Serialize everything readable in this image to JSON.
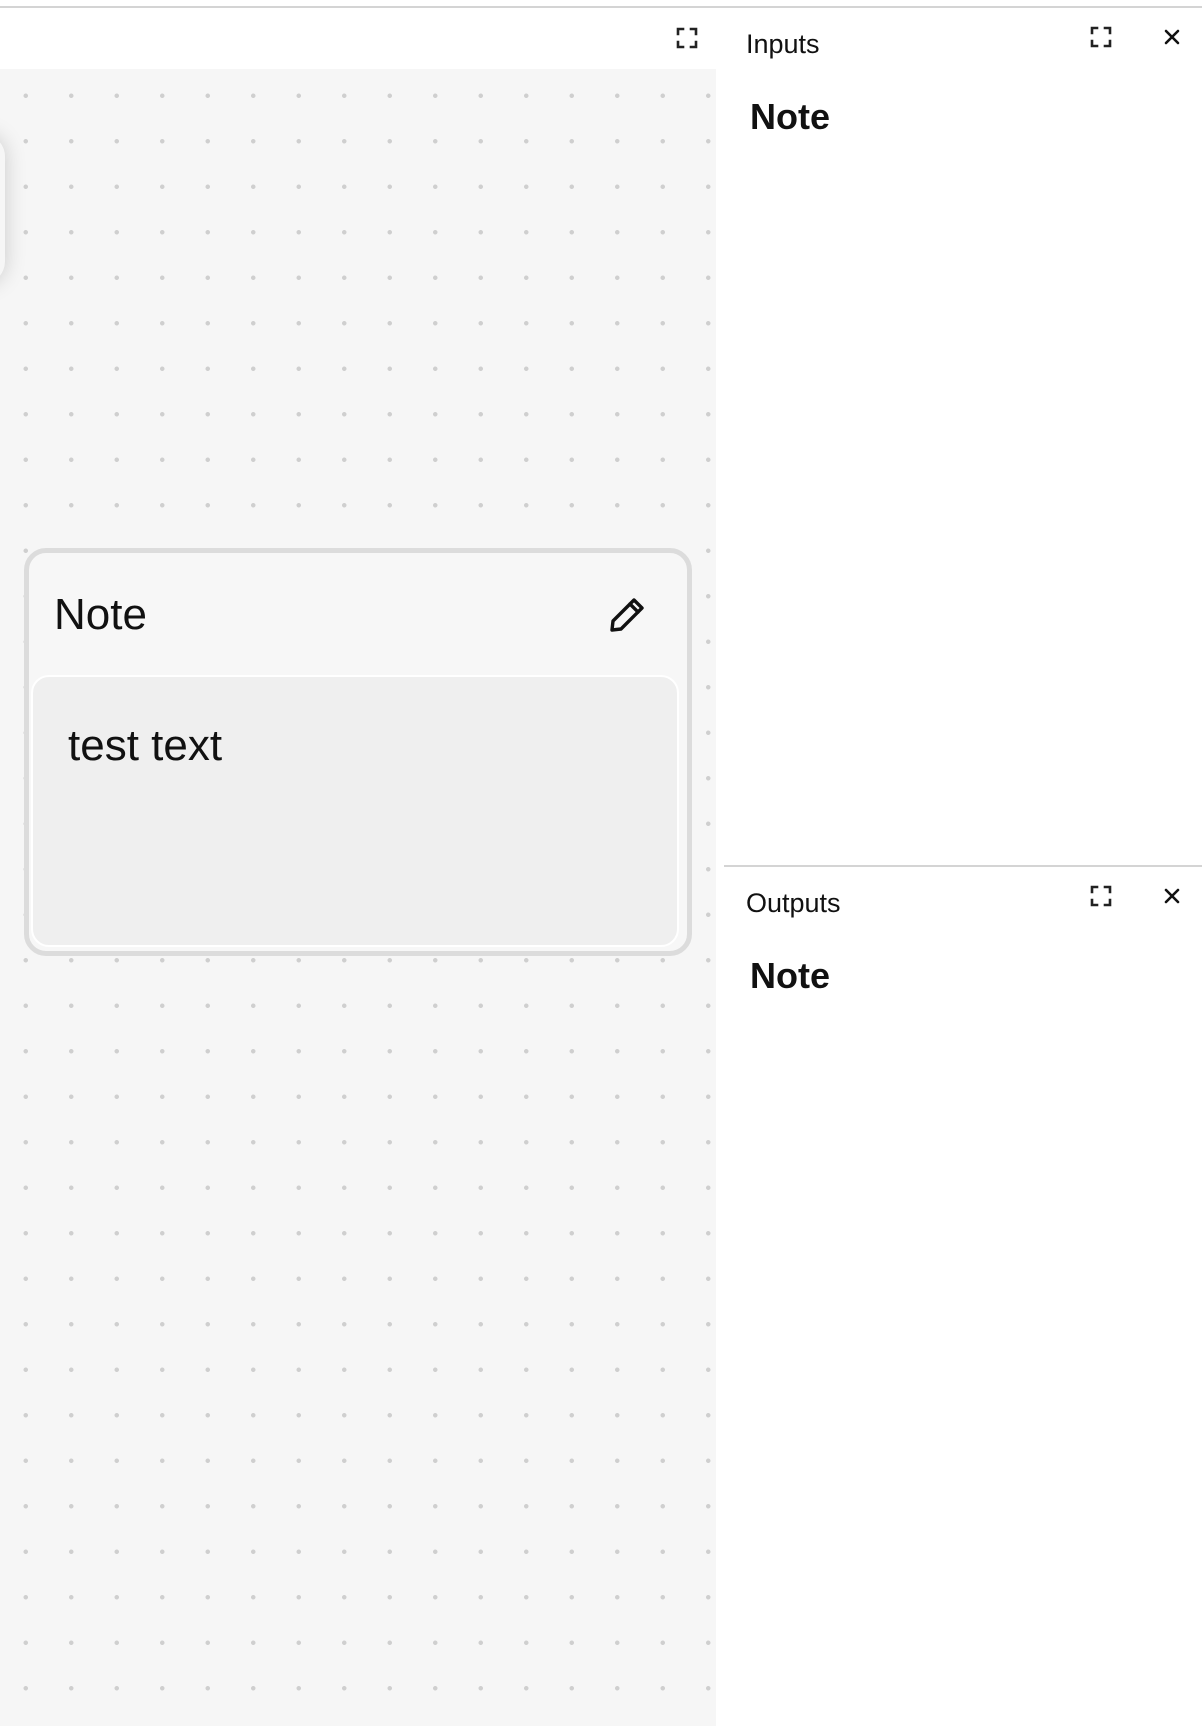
{
  "canvas": {
    "toolbar": {
      "expand_icon": "expand-icon"
    },
    "note_node": {
      "title": "Note",
      "edit_icon": "pencil-icon",
      "text": "test text"
    }
  },
  "inputs_panel": {
    "label": "Inputs",
    "heading": "Note",
    "expand_icon": "expand-icon",
    "close_icon": "close-icon"
  },
  "outputs_panel": {
    "label": "Outputs",
    "heading": "Note",
    "expand_icon": "expand-icon",
    "close_icon": "close-icon"
  },
  "colors": {
    "canvas_background": "#f6f6f6",
    "canvas_dot": "#cfcfcf",
    "node_border": "#dcdcdc",
    "node_body": "#efefef",
    "text": "#111111"
  }
}
